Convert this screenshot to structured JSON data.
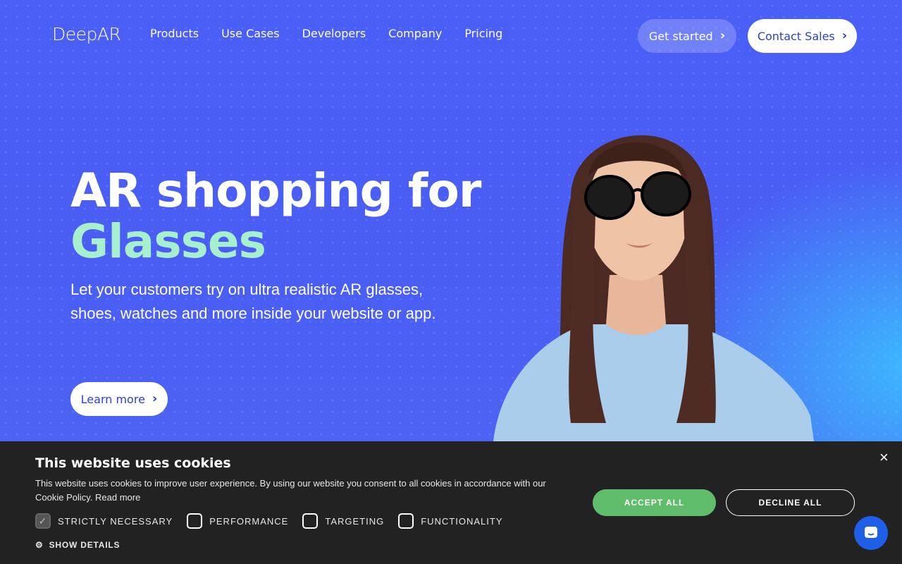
{
  "header": {
    "logo": "DeepAR",
    "nav": [
      "Products",
      "Use Cases",
      "Developers",
      "Company",
      "Pricing"
    ],
    "get_started": "Get started",
    "contact_sales": "Contact Sales"
  },
  "hero": {
    "title_line1": "AR shopping for",
    "title_line2": "Glasses",
    "subtitle": "Let your customers try on ultra realistic AR glasses, shoes, watches and more inside your website or app.",
    "learn_more": "Learn more"
  },
  "cookie": {
    "title": "This website uses cookies",
    "text": "This website uses cookies to improve user experience. By using our website you consent to all cookies in accordance with our Cookie Policy.",
    "read_more": "Read more",
    "options": [
      {
        "label": "STRICTLY NECESSARY",
        "checked": true
      },
      {
        "label": "PERFORMANCE",
        "checked": false
      },
      {
        "label": "TARGETING",
        "checked": false
      },
      {
        "label": "FUNCTIONALITY",
        "checked": false
      }
    ],
    "show_details": "SHOW DETAILS",
    "accept": "ACCEPT ALL",
    "decline": "DECLINE ALL",
    "close": "×"
  },
  "colors": {
    "hero_bg": "#4a5cf4",
    "accent_green": "#a7f0cf",
    "accept_green": "#5fbd6b",
    "cookie_bg": "#222222",
    "link_blue": "#2b3fd6"
  }
}
